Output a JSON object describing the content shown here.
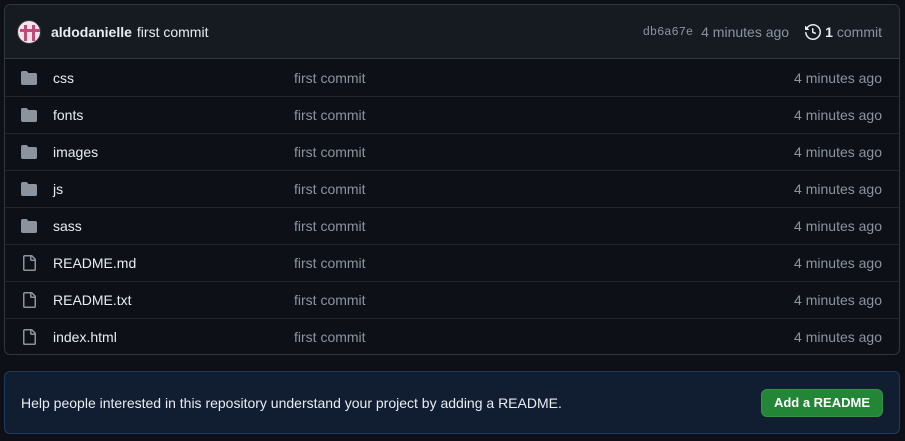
{
  "commit": {
    "author": "aldodanielle",
    "message": "first commit",
    "sha": "db6a67e",
    "time": "4 minutes ago",
    "count": "1",
    "count_label": "commit",
    "avatar_icon": "identicon-avatar"
  },
  "files": [
    {
      "name": "css",
      "type": "folder",
      "icon": "folder-icon",
      "message": "first commit",
      "time": "4 minutes ago"
    },
    {
      "name": "fonts",
      "type": "folder",
      "icon": "folder-icon",
      "message": "first commit",
      "time": "4 minutes ago"
    },
    {
      "name": "images",
      "type": "folder",
      "icon": "folder-icon",
      "message": "first commit",
      "time": "4 minutes ago"
    },
    {
      "name": "js",
      "type": "folder",
      "icon": "folder-icon",
      "message": "first commit",
      "time": "4 minutes ago"
    },
    {
      "name": "sass",
      "type": "folder",
      "icon": "folder-icon",
      "message": "first commit",
      "time": "4 minutes ago"
    },
    {
      "name": "README.md",
      "type": "file",
      "icon": "file-icon",
      "message": "first commit",
      "time": "4 minutes ago"
    },
    {
      "name": "README.txt",
      "type": "file",
      "icon": "file-icon",
      "message": "first commit",
      "time": "4 minutes ago"
    },
    {
      "name": "index.html",
      "type": "file",
      "icon": "file-icon",
      "message": "first commit",
      "time": "4 minutes ago"
    }
  ],
  "readme_banner": {
    "text": "Help people interested in this repository understand your project by adding a README.",
    "button_label": "Add a README"
  },
  "colors": {
    "background": "#0d1117",
    "accent_green": "#238636",
    "muted_text": "#8b949e",
    "icon_gray": "#8b949e",
    "banner_bg": "#111d30"
  }
}
